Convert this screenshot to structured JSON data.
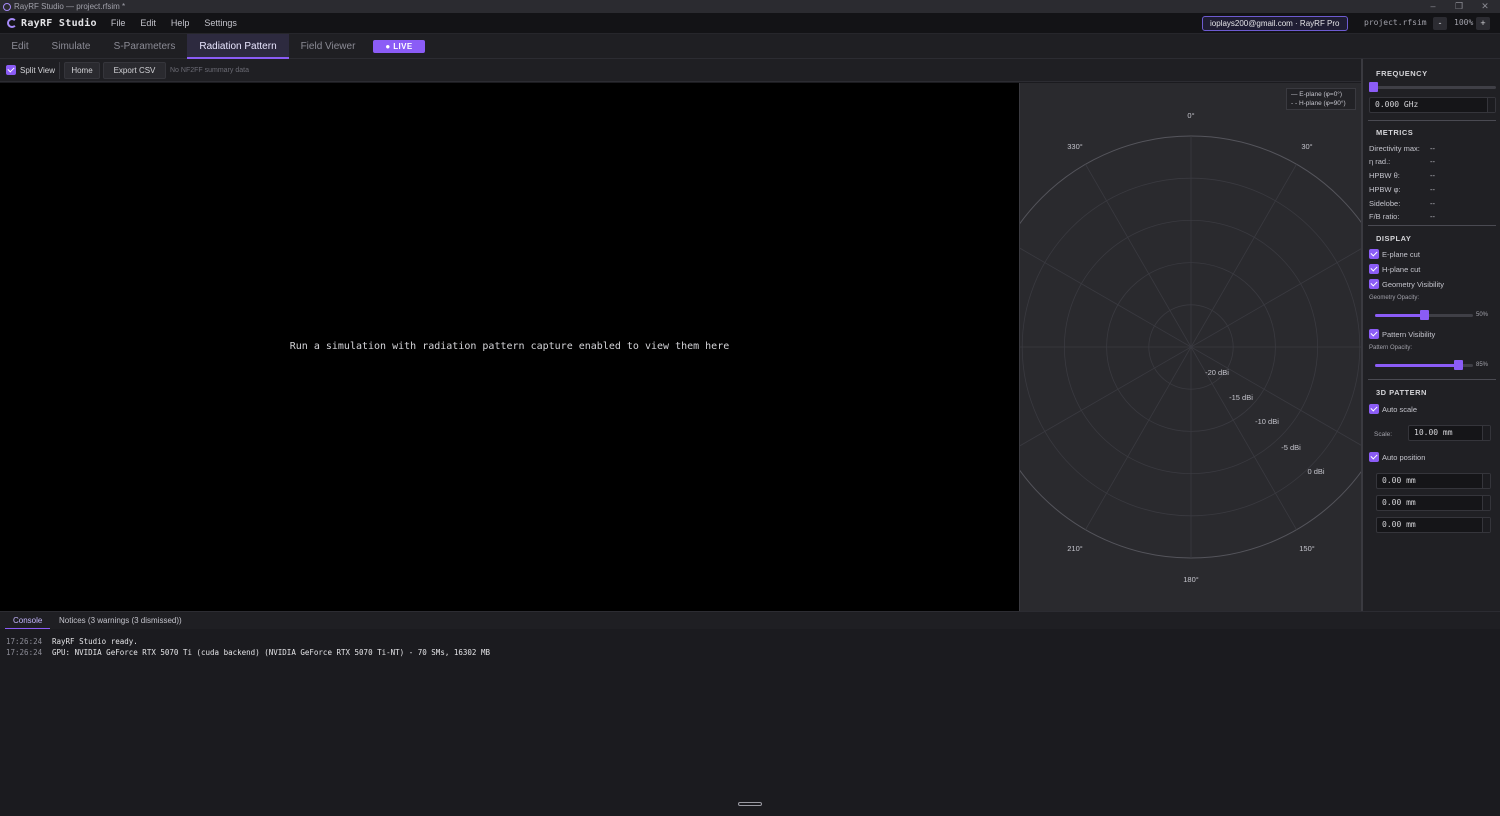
{
  "window": {
    "title": "RayRF Studio — project.rfsim *"
  },
  "menubar": {
    "brand": "RayRF Studio",
    "menus": [
      "File",
      "Edit",
      "Help",
      "Settings"
    ],
    "account": "ioplays200@gmail.com  ·  RayRF Pro",
    "filename": "project.rfsim",
    "zoom_minus": "-",
    "zoom": "100%",
    "zoom_plus": "+"
  },
  "tabs": {
    "items": [
      "Edit",
      "Simulate",
      "S-Parameters",
      "Radiation Pattern",
      "Field Viewer"
    ],
    "active": "Radiation Pattern",
    "live_label": "● LIVE"
  },
  "toolbar": {
    "split_view": "Split View",
    "home": "Home",
    "export_csv": "Export CSV",
    "note": "No NF2FF summary data"
  },
  "viewer": {
    "message": "Run a simulation with radiation pattern capture enabled to view them here"
  },
  "polar": {
    "legend": [
      "— E-plane (φ=0°)",
      "- - H-plane (φ=90°)"
    ],
    "angle_labels": {
      "a0": "0°",
      "a30": "30°",
      "a330": "330°",
      "a150": "150°",
      "a210": "210°",
      "a180": "180°"
    },
    "ring_labels": [
      "-20 dBi",
      "-15 dBi",
      "-10 dBi",
      "-5 dBi",
      "0 dBi"
    ]
  },
  "sidebar": {
    "frequency": {
      "title": "FREQUENCY",
      "value": "0.000 GHz",
      "slider_fraction": 0.0
    },
    "metrics": {
      "title": "METRICS",
      "rows": [
        {
          "label": "Directivity max:",
          "value": "--"
        },
        {
          "label": "η rad.:",
          "value": "--"
        },
        {
          "label": "HPBW θ:",
          "value": "--"
        },
        {
          "label": "HPBW φ:",
          "value": "--"
        },
        {
          "label": "Sidelobe:",
          "value": "--"
        },
        {
          "label": "F/B ratio:",
          "value": "--"
        }
      ]
    },
    "display": {
      "title": "DISPLAY",
      "e_plane": "E-plane cut",
      "h_plane": "H-plane cut",
      "geometry_visibility": "Geometry Visibility",
      "geometry_opacity_label": "Geometry Opacity:",
      "geometry_opacity": "50%",
      "geometry_opacity_value": 0.5,
      "pattern_visibility": "Pattern Visibility",
      "pattern_opacity_label": "Pattern Opacity:",
      "pattern_opacity": "85%",
      "pattern_opacity_value": 0.85
    },
    "pattern3d": {
      "title": "3D PATTERN",
      "auto_scale": "Auto scale",
      "scale_label": "Scale:",
      "scale_value": "10.00 mm",
      "auto_position": "Auto position",
      "positions": [
        "0.00 mm",
        "0.00 mm",
        "0.00 mm"
      ]
    }
  },
  "console": {
    "tabs": [
      "Console",
      "Notices (3 warnings (3 dismissed))"
    ],
    "logs": [
      {
        "time": "17:26:24",
        "message": "RayRF Studio ready."
      },
      {
        "time": "17:26:24",
        "message": "GPU: NVIDIA GeForce RTX 5070 Ti (cuda backend) (NVIDIA GeForce RTX 5070 Ti-NT) - 70 SMs, 16302 MB"
      }
    ]
  },
  "colors": {
    "accent": "#8b5cf6",
    "background": "#1b1b1f",
    "viewer": "#000000"
  }
}
